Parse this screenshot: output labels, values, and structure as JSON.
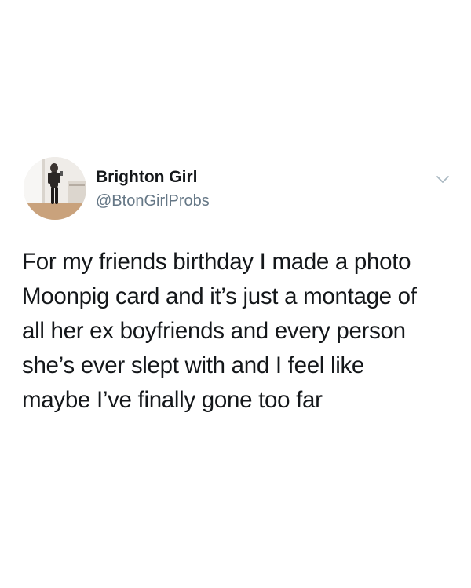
{
  "tweet": {
    "author": {
      "display_name": "Brighton Girl",
      "handle": "@BtonGirlProbs",
      "avatar_icon": "profile-photo-avatar"
    },
    "menu_icon": "chevron-down-icon",
    "text_lines": [
      "For my friends birthday I made a photo",
      "Moonpig card and it’s just a montage of",
      "all her ex boyfriends and every person",
      "she’s ever slept with and I feel like",
      "maybe I’ve finally gone too far"
    ]
  },
  "colors": {
    "background": "#ffffff",
    "text": "#14171a",
    "secondary_text": "#657786",
    "icon": "#aab8c2"
  }
}
